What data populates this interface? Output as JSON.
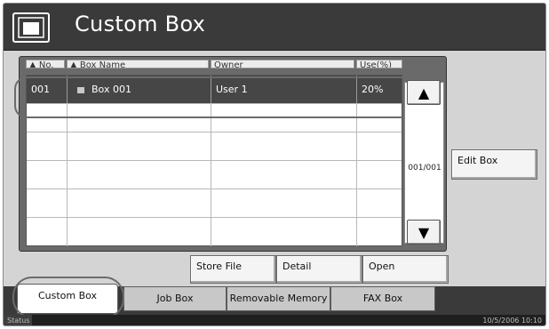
{
  "header": {
    "title": "Custom Box",
    "icon": "box-stack-icon"
  },
  "columns": [
    {
      "label": "No."
    },
    {
      "label": "Box Name"
    },
    {
      "label": "Owner"
    },
    {
      "label": "Use(%)"
    }
  ],
  "rows": [
    {
      "no": "001",
      "name": "Box 001",
      "owner": "User 1",
      "use": "20%",
      "selected": true
    },
    {
      "no": "",
      "name": "",
      "owner": "",
      "use": ""
    },
    {
      "no": "",
      "name": "",
      "owner": "",
      "use": ""
    },
    {
      "no": "",
      "name": "",
      "owner": "",
      "use": ""
    },
    {
      "no": "",
      "name": "",
      "owner": "",
      "use": ""
    },
    {
      "no": "",
      "name": "",
      "owner": "",
      "use": ""
    }
  ],
  "pager": {
    "position": "001/001",
    "up_icon": "triangle-up-icon",
    "down_icon": "triangle-down-icon"
  },
  "buttons": {
    "edit_box": "Edit Box",
    "store_file": "Store File",
    "detail": "Detail",
    "open": "Open"
  },
  "tabs": [
    "Custom Box",
    "Job Box",
    "Removable Memory",
    "FAX Box"
  ],
  "status": {
    "label": "Status",
    "datetime": "10/5/2006   10:10"
  },
  "colors": {
    "header_bg": "#3a3a3a",
    "panel_bg": "#d4d4d4",
    "selected_row": "#464646"
  }
}
